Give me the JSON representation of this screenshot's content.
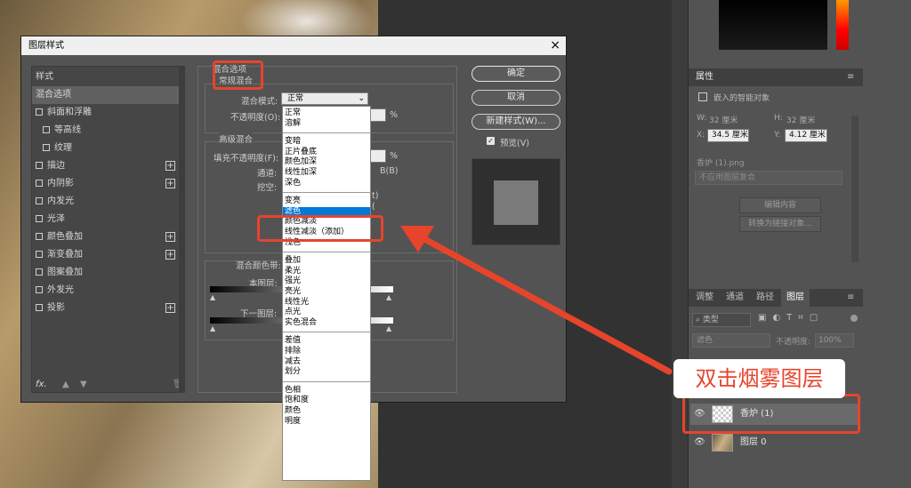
{
  "dialog": {
    "title": "图层样式",
    "close": "×",
    "styles_header": "样式",
    "style_items": [
      {
        "label": "混合选项",
        "checkbox": false,
        "plus": false,
        "selected": true
      },
      {
        "label": "斜面和浮雕",
        "checkbox": true,
        "plus": false
      },
      {
        "label": "等高线",
        "checkbox": true,
        "plus": false,
        "indent": true
      },
      {
        "label": "纹理",
        "checkbox": true,
        "plus": false,
        "indent": true
      },
      {
        "label": "描边",
        "checkbox": true,
        "plus": true
      },
      {
        "label": "内阴影",
        "checkbox": true,
        "plus": true
      },
      {
        "label": "内发光",
        "checkbox": true,
        "plus": false
      },
      {
        "label": "光泽",
        "checkbox": true,
        "plus": false
      },
      {
        "label": "颜色叠加",
        "checkbox": true,
        "plus": true
      },
      {
        "label": "渐变叠加",
        "checkbox": true,
        "plus": true
      },
      {
        "label": "图案叠加",
        "checkbox": true,
        "plus": false
      },
      {
        "label": "外发光",
        "checkbox": true,
        "plus": false
      },
      {
        "label": "投影",
        "checkbox": true,
        "plus": true
      }
    ],
    "blend_options_title": "混合选项",
    "normal_blend": "常规混合",
    "blend_mode_label": "混合模式:",
    "blend_mode_value": "正常",
    "opacity_label": "不透明度(O):",
    "percent": "%",
    "advanced_blend": "高级混合",
    "fill_opacity_label": "填充不透明度(F):",
    "channels_label": "通道:",
    "channel_b": "B(B)",
    "knockout_label": "挖空:",
    "blend_if_label": "混合颜色带:",
    "this_layer_label": "本图层:",
    "underlying_layer_label": "下一图层:",
    "ok": "确定",
    "cancel": "取消",
    "new_style": "新建样式(W)...",
    "preview_label": "预览(V)",
    "fx": "fx.",
    "blend_modes": [
      [
        "正常",
        "溶解"
      ],
      [
        "变暗",
        "正片叠底",
        "颜色加深",
        "线性加深",
        "深色"
      ],
      [
        "变亮",
        "滤色",
        "颜色减淡",
        "线性减淡（添加）",
        "浅色"
      ],
      [
        "叠加",
        "柔光",
        "强光",
        "亮光",
        "线性光",
        "点光",
        "实色混合"
      ],
      [
        "差值",
        "排除",
        "减去",
        "划分"
      ],
      [
        "色相",
        "饱和度",
        "颜色",
        "明度"
      ]
    ],
    "highlighted_mode": "滤色"
  },
  "properties_panel": {
    "title": "属性",
    "smart_object": "嵌入的智能对象",
    "w_label": "W:",
    "w_value": "32 厘米",
    "h_label": "H:",
    "h_value": "32 厘米",
    "x_label": "X:",
    "x_value": "34.5 厘米",
    "y_label": "Y:",
    "y_value": "4.12 厘米",
    "file_name": "香炉 (1).png",
    "comp_select": "不应用图层复合",
    "edit_contents": "编辑内容",
    "convert_link": "转换为链接对象..."
  },
  "layers_panel": {
    "tabs": [
      "调整",
      "通道",
      "路径",
      "图层"
    ],
    "active_tab": "图层",
    "filter_label": "类型",
    "blend_value": "滤色",
    "opacity_label": "不透明度:",
    "opacity_value": "100%",
    "layers": [
      {
        "name": "香炉 (1)",
        "selected": true
      },
      {
        "name": "图层 0",
        "selected": false
      }
    ]
  },
  "annotation": {
    "callout": "双击烟雾图层",
    "color": "#e7442c"
  }
}
